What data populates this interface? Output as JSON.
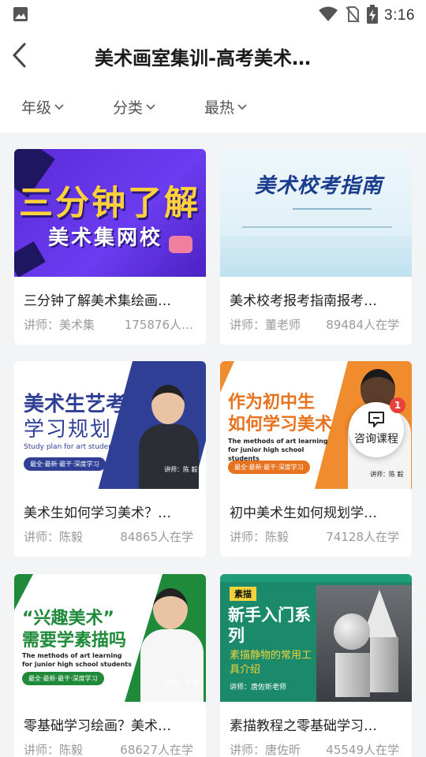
{
  "status_bar": {
    "time": "3:16"
  },
  "header": {
    "title": "美术画室集训-高考美术…"
  },
  "filters": [
    {
      "label": "年级"
    },
    {
      "label": "分类"
    },
    {
      "label": "最热"
    }
  ],
  "courses": [
    {
      "title": "三分钟了解美术集绘画…",
      "teacher": "讲师：美术集",
      "count": "175876人…",
      "thumb": {
        "line1": "三分钟了解",
        "line2": "美术集网校"
      }
    },
    {
      "title": "美术校考报考指南报考…",
      "teacher": "讲师：董老师",
      "count": "89484人在学",
      "thumb": {
        "heading": "美术校考指南"
      }
    },
    {
      "title": "美术生如何学习美术？…",
      "teacher": "讲师：陈毅",
      "count": "84865人在学",
      "thumb": {
        "line1": "美术生艺考",
        "line2": "学习规划",
        "en": "Study plan for art students",
        "tag": "最全·最新·最干·深度学习",
        "teacher": "讲师：陈 毅"
      }
    },
    {
      "title": "初中美术生如何规划学…",
      "teacher": "讲师：陈毅",
      "count": "74128人在学",
      "thumb": {
        "line1": "作为初中生",
        "line2": "如何学习美术",
        "en": "The methods of art learning for junior high school students",
        "tag": "最全·最新·最干·深度学习",
        "teacher": "讲师：陈 毅"
      }
    },
    {
      "title": "零基础学习绘画？美术…",
      "teacher": "讲师：陈毅",
      "count": "68627人在学",
      "thumb": {
        "line1": "“兴趣美术”",
        "line2": "需要学素描吗",
        "en": "The methods of art learning for junior high school students",
        "tag": "最全·最新·最干·深度学习",
        "teacher": "讲师：陈 毅"
      }
    },
    {
      "title": "素描教程之零基础学习…",
      "teacher": "讲师：唐佐昕",
      "count": "45549人在学",
      "thumb": {
        "tag": "素描",
        "line1": "新手入门系",
        "line2": "列",
        "sub1": "素描静物的常用工",
        "sub2": "具介绍",
        "teacher": "讲师：唐佐昕老师"
      }
    }
  ],
  "consult": {
    "label": "咨询课程",
    "badge": "1"
  }
}
